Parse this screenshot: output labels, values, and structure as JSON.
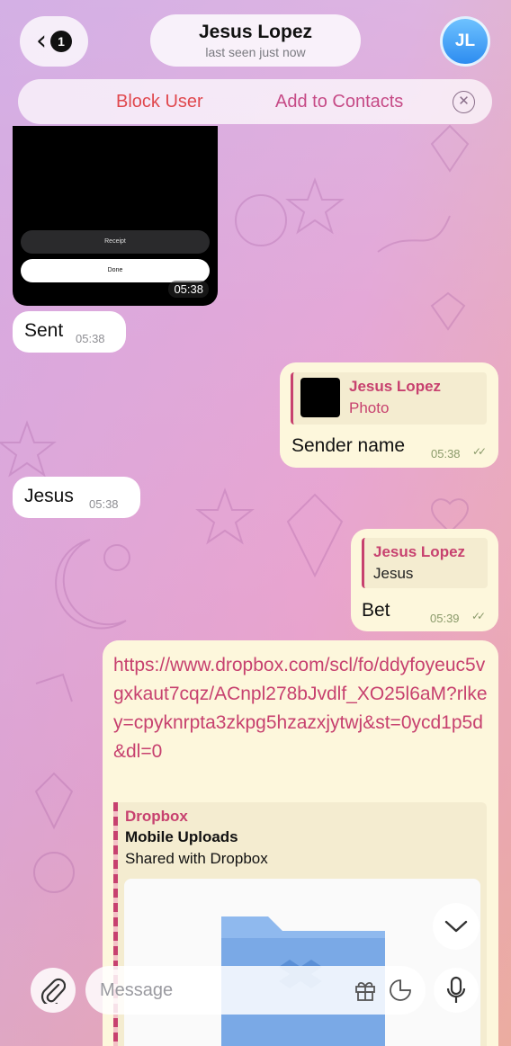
{
  "header": {
    "back_count": "1",
    "contact_name": "Jesus Lopez",
    "contact_status": "last seen just now",
    "avatar_initials": "JL"
  },
  "action_bar": {
    "block_label": "Block User",
    "add_label": "Add to Contacts"
  },
  "messages": [
    {
      "type": "media",
      "buttons": [
        "Receipt",
        "Done"
      ],
      "time": "05:38"
    },
    {
      "type": "incoming",
      "text": "Sent",
      "time": "05:38"
    },
    {
      "type": "outgoing",
      "reply_name": "Jesus Lopez",
      "reply_text": "Photo",
      "text": "Sender name",
      "time": "05:38"
    },
    {
      "type": "incoming",
      "text": "Jesus",
      "time": "05:38"
    },
    {
      "type": "outgoing",
      "reply_name": "Jesus Lopez",
      "reply_text": "Jesus",
      "text": "Bet",
      "time": "05:39"
    },
    {
      "type": "outgoing_link",
      "url": "https://www.dropbox.com/scl/fo/ddyfoyeuc5vgxkaut7cqz/ACnpl278bJvdlf_XO25l6aM?rlkey=cpyknrpta3zkpg5hzazxjytwj&st=0ycd1p5d&dl=0",
      "preview": {
        "site": "Dropbox",
        "title": "Mobile Uploads",
        "description": "Shared with Dropbox"
      }
    }
  ],
  "composer": {
    "placeholder": "Message"
  },
  "colors": {
    "accent": "#c7416f",
    "block_red": "#e0484e",
    "outgoing_bubble": "#fdf7dc",
    "avatar_blue": "#2d8cf0"
  },
  "icons": [
    "back-chevron-icon",
    "close-icon",
    "double-check-icon",
    "folder-icon",
    "chevron-down-icon",
    "paperclip-icon",
    "gift-icon",
    "sticker-icon",
    "microphone-icon"
  ]
}
